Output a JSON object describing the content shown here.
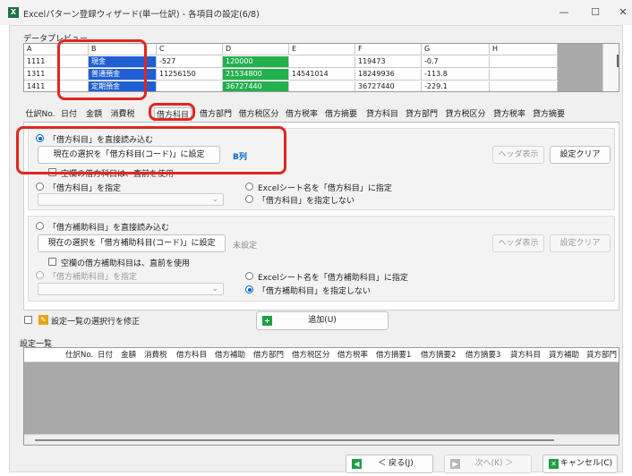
{
  "window": {
    "title": "Excelパターン登録ウィザード(単一仕訳) - 各項目の設定(6/8)",
    "app_icon_glyph": "X",
    "minimize_glyph": "—",
    "maximize_glyph": "☐",
    "close_glyph": "✕"
  },
  "preview": {
    "group_label": "データプレビュー",
    "columns": [
      "A",
      "B",
      "C",
      "D",
      "E",
      "F",
      "G",
      "H"
    ],
    "rows": [
      [
        "1111",
        "現金",
        "-527",
        "120000",
        "",
        "119473",
        "-0.7",
        ""
      ],
      [
        "1311",
        "普通預金",
        "11256150",
        "21534800",
        "14541014",
        "18249936",
        "-113.8",
        ""
      ],
      [
        "1411",
        "定期預金",
        "",
        "36727440",
        "",
        "36727440",
        "-229.1",
        ""
      ]
    ],
    "highlight_colors": {
      "col_b": "#1f5fd6",
      "col_d": "#22b14c"
    }
  },
  "tabs": [
    {
      "label": "仕訳No."
    },
    {
      "label": "日付"
    },
    {
      "label": "金額"
    },
    {
      "label": "消費税"
    },
    {
      "label": "借方科目",
      "active": true
    },
    {
      "label": "借方部門"
    },
    {
      "label": "借方税区分"
    },
    {
      "label": "借方税率"
    },
    {
      "label": "借方摘要"
    },
    {
      "label": "貸方科目"
    },
    {
      "label": "貸方部門"
    },
    {
      "label": "貸方税区分"
    },
    {
      "label": "貸方税率"
    },
    {
      "label": "貸方摘要"
    }
  ],
  "account_section": {
    "radio_direct": "「借方科目」を直接読み込む",
    "set_code_button": "現在の選択を「借方科目(コード)」に設定",
    "current_value": "B列",
    "header_button": "ヘッダ表示",
    "clear_button": "設定クリア",
    "checkbox_blank": "空欄の借方科目は、直前を使用",
    "radio_specify": "「借方科目」を指定",
    "radio_sheetname": "Excelシート名を「借方科目」に指定",
    "radio_none": "「借方科目」を指定しない"
  },
  "sub_section": {
    "radio_direct": "「借方補助科目」を直接読み込む",
    "set_code_button": "現在の選択を「借方補助科目(コード)」に設定",
    "current_value": "未設定",
    "header_button": "ヘッダ表示",
    "clear_button": "設定クリア",
    "checkbox_blank": "空欄の借方補助科目は、直前を使用",
    "radio_specify": "「借方補助科目」を指定",
    "radio_sheetname": "Excelシート名を「借方補助科目」に指定",
    "radio_none": "「借方補助科目」を指定しない"
  },
  "modify_checkbox": "設定一覧の選択行を修正",
  "add_button": "追加(U)",
  "settings_list": {
    "group_label": "設定一覧",
    "columns": [
      "仕訳No.",
      "日付",
      "金額",
      "消費税",
      "借方科目",
      "借方補助",
      "借方部門",
      "借方税区分",
      "借方税率",
      "借方摘要1",
      "借方摘要2",
      "借方摘要3",
      "貸方科目",
      "貸方補助",
      "貸方部門"
    ]
  },
  "footer": {
    "back_button": "＜ 戻る(J)",
    "next_button": "次へ(K) ＞",
    "cancel_button": "キャンセル(C)"
  },
  "colors": {
    "annotation_red": "#e0271f",
    "accent_blue": "#0067c0",
    "green_icon": "#1e7145"
  }
}
